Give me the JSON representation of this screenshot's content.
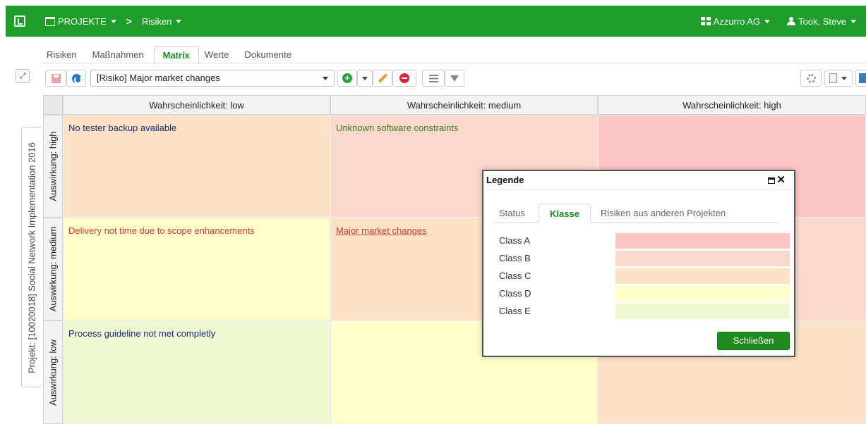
{
  "topbar": {
    "projects_label": "PROJEKTE",
    "breadcrumb_separator": ">",
    "current_module": "Risiken",
    "organization": "Azzurro AG",
    "user": "Took, Steve",
    "bg_color": "#1f9d2a"
  },
  "project_tab": {
    "label": "Projekt: [10020018] Social Network Implementation 2016"
  },
  "tabs": [
    {
      "label": "Risiken",
      "active": false
    },
    {
      "label": "Maßnahmen",
      "active": false
    },
    {
      "label": "Matrix",
      "active": true
    },
    {
      "label": "Werte",
      "active": false
    },
    {
      "label": "Dokumente",
      "active": false
    }
  ],
  "toolbar": {
    "risk_select_value": "[Risiko] Major market changes"
  },
  "matrix": {
    "col_headers": [
      "Wahrscheinlichkeit: low",
      "Wahrscheinlichkeit: medium",
      "Wahrscheinlichkeit: high"
    ],
    "row_headers": [
      "Auswirkung: high",
      "Auswirkung: medium",
      "Auswirkung: low"
    ],
    "cells": [
      [
        {
          "text": "No tester backup available",
          "color": "#fde2c6"
        },
        {
          "text": "Unknown software constraints",
          "color": "#fcd8cc"
        },
        {
          "text": "",
          "color": "#fcc6c6"
        }
      ],
      [
        {
          "text": "Delivery not time due to scope enhancements",
          "color": "#ffffcc"
        },
        {
          "text": "Major market changes",
          "color": "#fde2c6"
        },
        {
          "text": "",
          "color": "#fcd8cc"
        }
      ],
      [
        {
          "text": "Process guideline not met completly",
          "color": "#eef9d4"
        },
        {
          "text": "",
          "color": "#ffffcc"
        },
        {
          "text": "",
          "color": "#fde2c6"
        }
      ]
    ]
  },
  "legend_dialog": {
    "title": "Legende",
    "tabs": [
      {
        "label": "Status",
        "active": false
      },
      {
        "label": "Klasse",
        "active": true
      },
      {
        "label": "Risiken aus anderen Projekten",
        "active": false
      }
    ],
    "classes": [
      {
        "label": "Class A",
        "color": "#fcc6c6"
      },
      {
        "label": "Class B",
        "color": "#fcd8cc"
      },
      {
        "label": "Class C",
        "color": "#fde2c6"
      },
      {
        "label": "Class D",
        "color": "#ffffcc"
      },
      {
        "label": "Class E",
        "color": "#eef9d4"
      }
    ],
    "close_label": "Schließen"
  },
  "colors": {
    "accent_green": "#1f8a1f",
    "risk_text_navy": "#1d2a7a",
    "risk_text_green": "#3b7d1e",
    "risk_text_red": "#d23a36"
  }
}
